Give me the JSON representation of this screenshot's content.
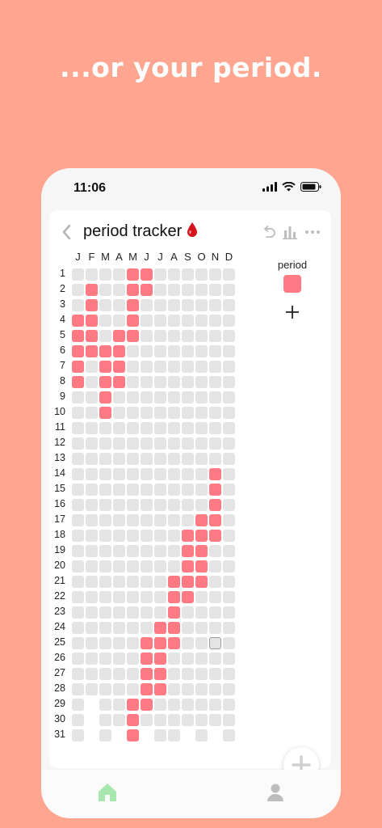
{
  "headline": "...or your period.",
  "status_bar": {
    "time": "11:06",
    "icons": [
      "signal-icon",
      "wifi-icon",
      "battery-icon"
    ]
  },
  "header": {
    "title": "period tracker",
    "title_emoji": "drop-of-blood-icon",
    "back_icon": "chevron-left-icon",
    "actions": [
      "undo-icon",
      "bar-chart-icon",
      "more-icon"
    ]
  },
  "months": [
    "J",
    "F",
    "M",
    "A",
    "M",
    "J",
    "J",
    "A",
    "S",
    "O",
    "N",
    "D"
  ],
  "days": [
    "1",
    "2",
    "3",
    "4",
    "5",
    "6",
    "7",
    "8",
    "9",
    "10",
    "11",
    "12",
    "13",
    "14",
    "15",
    "16",
    "17",
    "18",
    "19",
    "20",
    "21",
    "22",
    "23",
    "24",
    "25",
    "26",
    "27",
    "28",
    "29",
    "30",
    "31"
  ],
  "month_lengths": [
    31,
    28,
    31,
    30,
    31,
    30,
    31,
    31,
    30,
    31,
    30,
    31
  ],
  "marked_days": [
    [
      4,
      5,
      6,
      7,
      8
    ],
    [
      2,
      3,
      4,
      5,
      6
    ],
    [
      6,
      7,
      8,
      9,
      10
    ],
    [
      5,
      6,
      7,
      8
    ],
    [
      1,
      2,
      3,
      4,
      5,
      29,
      30,
      31
    ],
    [
      1,
      2,
      25,
      26,
      27,
      28,
      29
    ],
    [
      24,
      25,
      26,
      27,
      28
    ],
    [
      21,
      22,
      23,
      24,
      25
    ],
    [
      18,
      19,
      20,
      21,
      22
    ],
    [
      17,
      18,
      19,
      20,
      21
    ],
    [
      14,
      15,
      16,
      17,
      18
    ],
    []
  ],
  "today": {
    "month_index": 10,
    "day": 25
  },
  "legend": {
    "label": "period",
    "color": "#FF7A82"
  },
  "colors": {
    "background": "#FFA590",
    "marked": "#FF7A82",
    "empty": "#E4E4E4",
    "home_active": "#A8E6B0",
    "inactive_icon": "#BDBDBD"
  },
  "tabbar": [
    "home-icon",
    "profile-icon"
  ]
}
